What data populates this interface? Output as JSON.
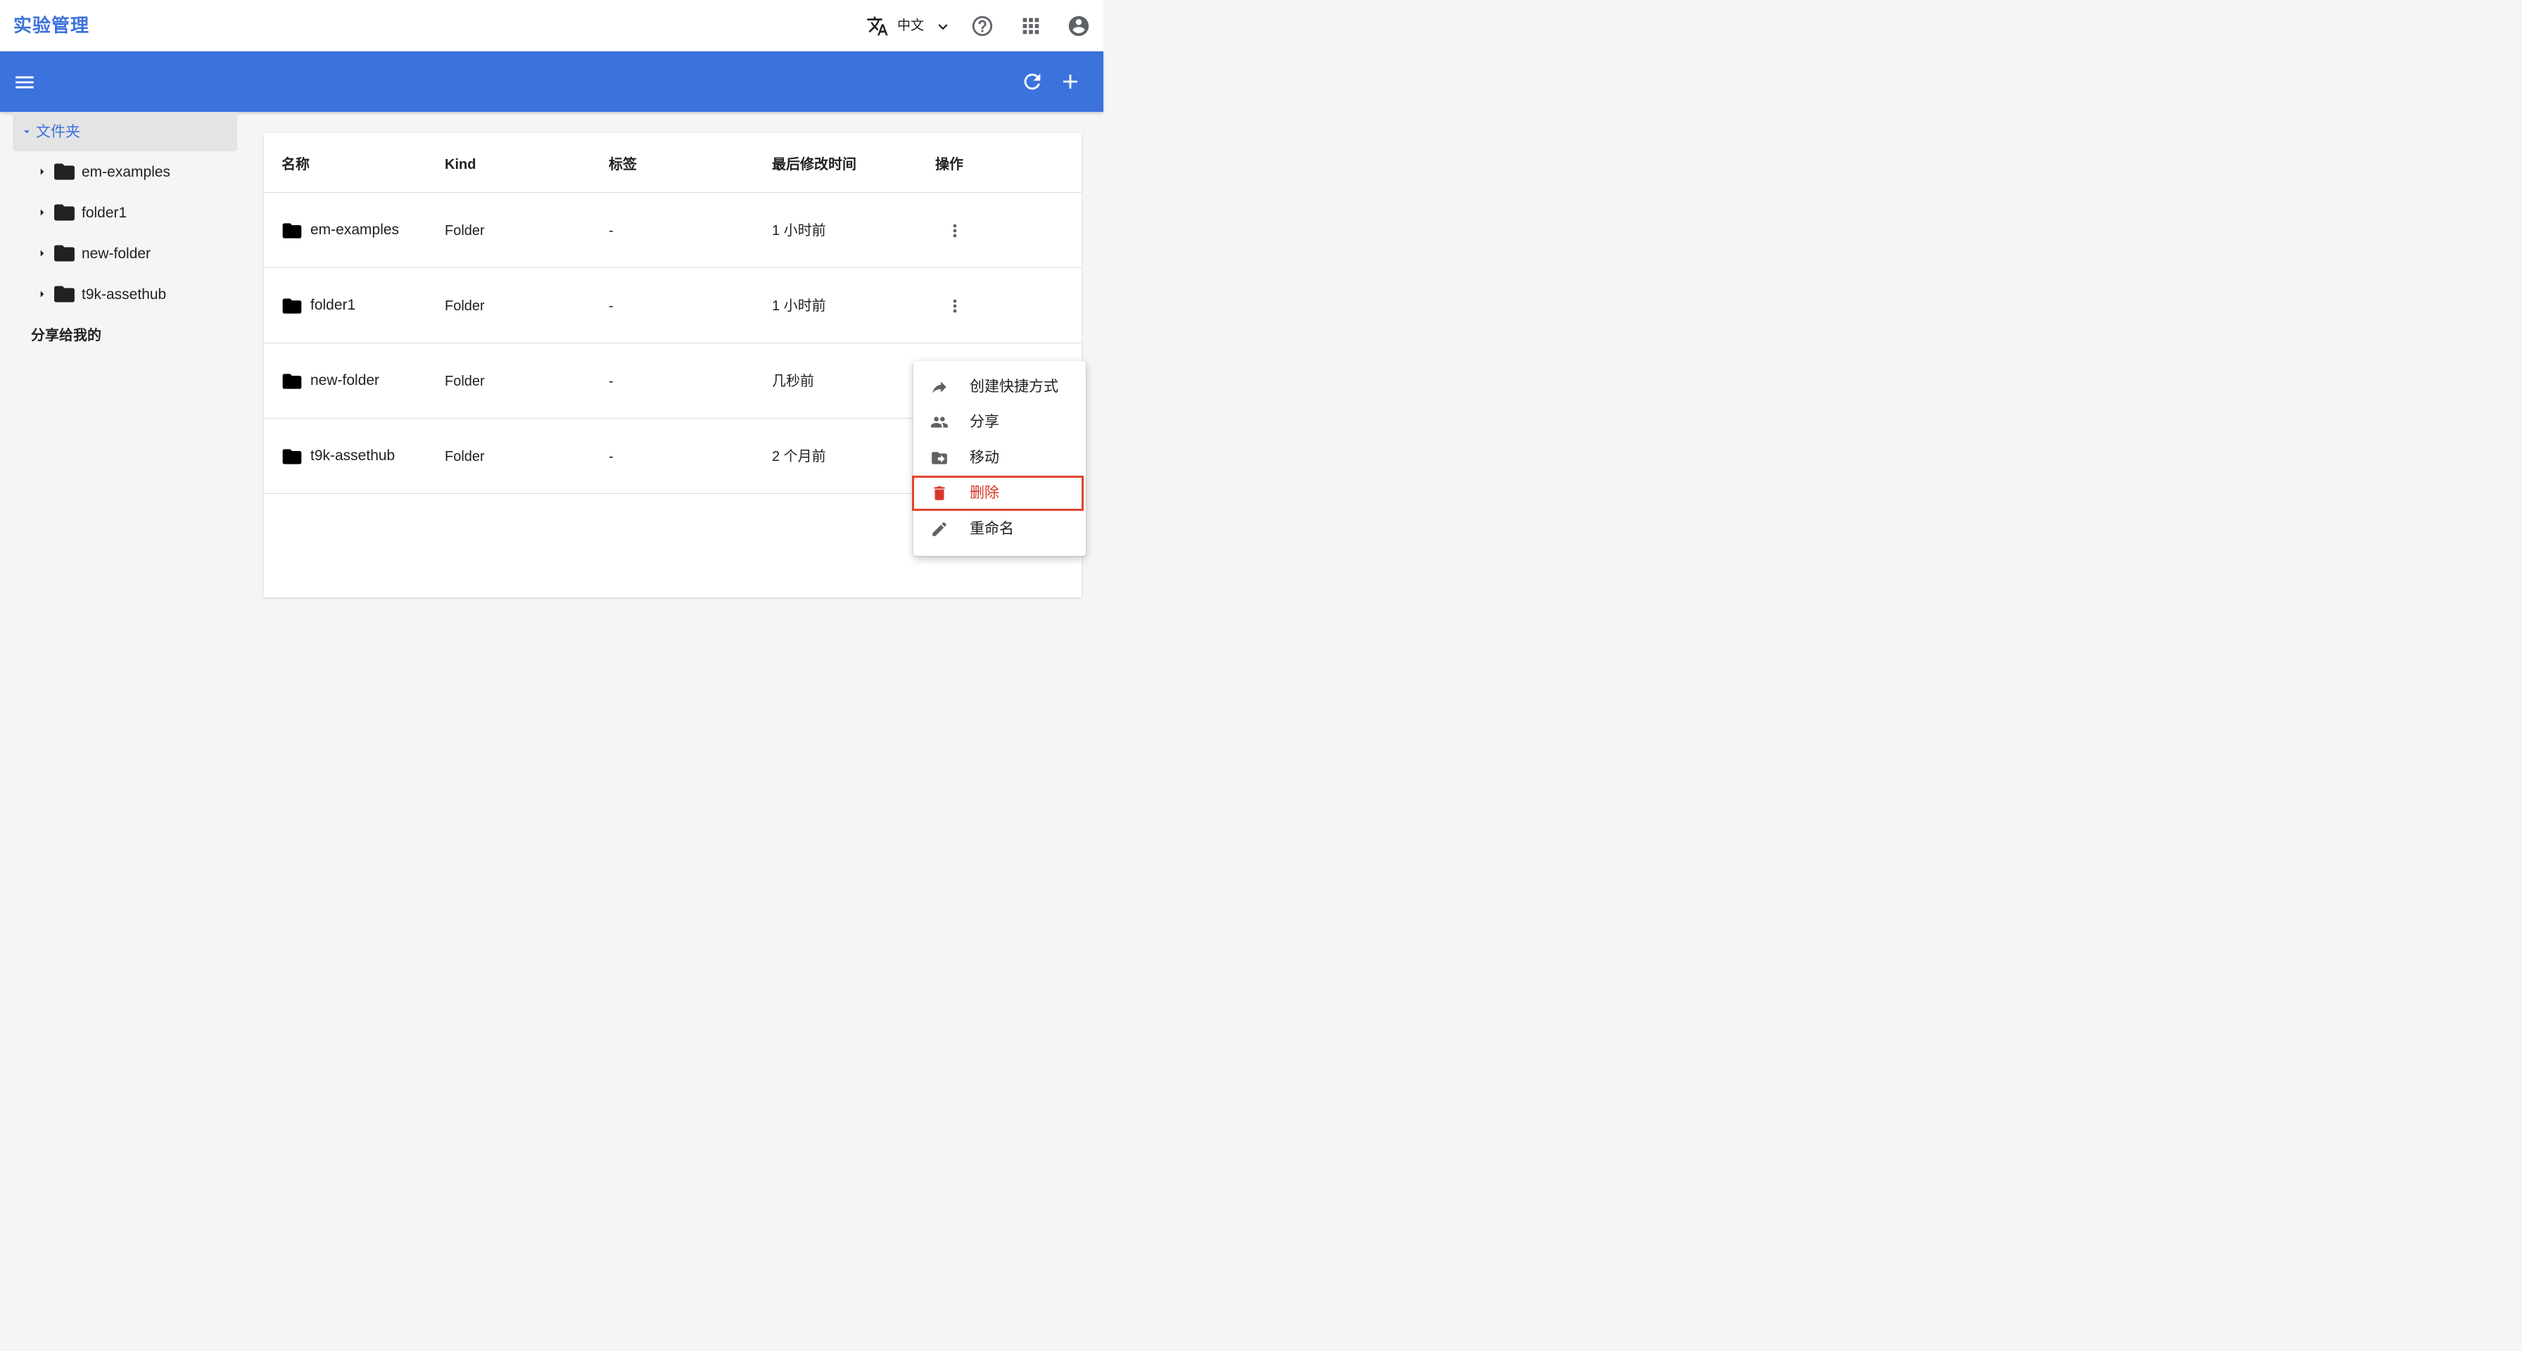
{
  "header": {
    "app_title": "实验管理",
    "language": "中文",
    "icons": [
      "translate-icon",
      "chevron-down-icon",
      "help-icon",
      "apps-icon",
      "account-icon"
    ]
  },
  "toolbar": {
    "icons": [
      "menu-icon",
      "refresh-icon",
      "add-icon"
    ]
  },
  "sidebar": {
    "root_label": "文件夹",
    "items": [
      {
        "label": "em-examples"
      },
      {
        "label": "folder1"
      },
      {
        "label": "new-folder"
      },
      {
        "label": "t9k-assethub"
      }
    ],
    "shared_label": "分享给我的"
  },
  "table": {
    "columns": [
      "名称",
      "Kind",
      "标签",
      "最后修改时间",
      "操作"
    ],
    "rows": [
      {
        "name": "em-examples",
        "kind": "Folder",
        "tags": "-",
        "modified": "1 小时前"
      },
      {
        "name": "folder1",
        "kind": "Folder",
        "tags": "-",
        "modified": "1 小时前"
      },
      {
        "name": "new-folder",
        "kind": "Folder",
        "tags": "-",
        "modified": "几秒前"
      },
      {
        "name": "t9k-assethub",
        "kind": "Folder",
        "tags": "-",
        "modified": "2 个月前"
      }
    ]
  },
  "context_menu": {
    "items": [
      {
        "label": "创建快捷方式",
        "icon": "shortcut-icon"
      },
      {
        "label": "分享",
        "icon": "people-icon"
      },
      {
        "label": "移动",
        "icon": "move-folder-icon"
      },
      {
        "label": "删除",
        "icon": "delete-icon",
        "danger": true,
        "highlighted": true
      },
      {
        "label": "重命名",
        "icon": "rename-icon"
      }
    ]
  },
  "colors": {
    "brand": "#3c72dc",
    "danger": "#d9372b",
    "highlight_border": "#e0432e"
  }
}
